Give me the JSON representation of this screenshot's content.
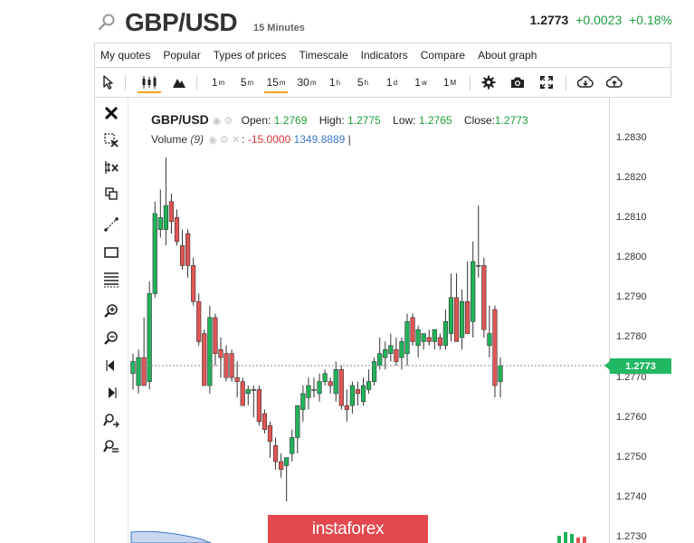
{
  "header": {
    "symbol": "GBP/USD",
    "timeframe": "15 Minutes",
    "price": "1.2773",
    "change": "+0.0023",
    "change_pct": "+0.18%",
    "search_icon": "search-icon"
  },
  "menu": {
    "items": [
      "My quotes",
      "Popular",
      "Types of prices",
      "Timescale",
      "Indicators",
      "Compare",
      "About graph"
    ]
  },
  "toolbar": {
    "timeframes": [
      {
        "base": "1",
        "sup": "m"
      },
      {
        "base": "5",
        "sup": "m"
      },
      {
        "base": "15",
        "sup": "m"
      },
      {
        "base": "30",
        "sup": "m"
      },
      {
        "base": "1",
        "sup": "h"
      },
      {
        "base": "5",
        "sup": "h"
      },
      {
        "base": "1",
        "sup": "d"
      },
      {
        "base": "1",
        "sup": "w"
      },
      {
        "base": "1",
        "sup": "M"
      }
    ],
    "active_timeframe": "15m",
    "icons": [
      "cursor-icon",
      "candlestick-icon",
      "mountain-icon",
      "gear-icon",
      "camera-icon",
      "fullscreen-icon",
      "download-icon",
      "upload-icon"
    ]
  },
  "tools": {
    "icons": [
      "close-icon",
      "delete-selection-icon",
      "delete-all-icon",
      "copy-icon",
      "line-icon",
      "rectangle-icon",
      "fibonacci-icon",
      "zoom-in-icon",
      "zoom-out-icon",
      "scroll-left-icon",
      "scroll-right-icon",
      "share-icon",
      "share-settings-icon"
    ]
  },
  "legend": {
    "symbol": "GBP/USD",
    "open_label": "Open:",
    "open": "1.2769",
    "high_label": "High:",
    "high": "1.2775",
    "low_label": "Low:",
    "low": "1.2765",
    "close_label": "Close:",
    "close": "1.2773",
    "volume_label": "Volume",
    "volume_param": "(9)",
    "volume_sep": ":",
    "volume_neg": "-15.0000",
    "volume_pos": "1349.8889",
    "volume_end": "|"
  },
  "axis": {
    "ticks": [
      "1.2830",
      "1.2820",
      "1.2810",
      "1.2800",
      "1.2790",
      "1.2780",
      "1.2770",
      "1.2760",
      "1.2750",
      "1.2740",
      "1.2730"
    ],
    "current_price": "1.2773"
  },
  "watermark": "instaforex",
  "colors": {
    "up": "#21b25a",
    "down": "#e05555",
    "accent": "#f0a31b",
    "price_tag": "#21b861"
  },
  "chart_data": {
    "type": "candlestick",
    "ylim": [
      1.2728,
      1.2836
    ],
    "last_price": 1.2773,
    "candles": [
      {
        "o": 1.2771,
        "h": 1.2776,
        "l": 1.2767,
        "c": 1.2774
      },
      {
        "o": 1.2768,
        "h": 1.2777,
        "l": 1.2766,
        "c": 1.2775
      },
      {
        "o": 1.2775,
        "h": 1.2785,
        "l": 1.2768,
        "c": 1.2768
      },
      {
        "o": 1.2769,
        "h": 1.2794,
        "l": 1.2767,
        "c": 1.2791
      },
      {
        "o": 1.2791,
        "h": 1.2814,
        "l": 1.279,
        "c": 1.2811
      },
      {
        "o": 1.2807,
        "h": 1.2817,
        "l": 1.2805,
        "c": 1.281
      },
      {
        "o": 1.2807,
        "h": 1.2825,
        "l": 1.2803,
        "c": 1.2813
      },
      {
        "o": 1.2814,
        "h": 1.2816,
        "l": 1.2806,
        "c": 1.2809
      },
      {
        "o": 1.281,
        "h": 1.2812,
        "l": 1.2803,
        "c": 1.2804
      },
      {
        "o": 1.2803,
        "h": 1.2807,
        "l": 1.2797,
        "c": 1.2798
      },
      {
        "o": 1.2806,
        "h": 1.2807,
        "l": 1.2795,
        "c": 1.2798
      },
      {
        "o": 1.2798,
        "h": 1.28,
        "l": 1.2788,
        "c": 1.2789
      },
      {
        "o": 1.2789,
        "h": 1.2791,
        "l": 1.2778,
        "c": 1.2779
      },
      {
        "o": 1.2781,
        "h": 1.2782,
        "l": 1.2768,
        "c": 1.2768
      },
      {
        "o": 1.2768,
        "h": 1.2788,
        "l": 1.2766,
        "c": 1.2785
      },
      {
        "o": 1.2785,
        "h": 1.2786,
        "l": 1.2773,
        "c": 1.2776
      },
      {
        "o": 1.2777,
        "h": 1.278,
        "l": 1.277,
        "c": 1.2775
      },
      {
        "o": 1.2776,
        "h": 1.2778,
        "l": 1.2769,
        "c": 1.277
      },
      {
        "o": 1.2776,
        "h": 1.2777,
        "l": 1.2769,
        "c": 1.277
      },
      {
        "o": 1.277,
        "h": 1.2774,
        "l": 1.2765,
        "c": 1.2769
      },
      {
        "o": 1.2769,
        "h": 1.277,
        "l": 1.2763,
        "c": 1.2763
      },
      {
        "o": 1.2766,
        "h": 1.2768,
        "l": 1.2763,
        "c": 1.2767
      },
      {
        "o": 1.2767,
        "h": 1.2768,
        "l": 1.276,
        "c": 1.2767
      },
      {
        "o": 1.2767,
        "h": 1.2768,
        "l": 1.2758,
        "c": 1.2759
      },
      {
        "o": 1.2761,
        "h": 1.2762,
        "l": 1.2756,
        "c": 1.2757
      },
      {
        "o": 1.2758,
        "h": 1.2759,
        "l": 1.275,
        "c": 1.2754
      },
      {
        "o": 1.2753,
        "h": 1.2755,
        "l": 1.2747,
        "c": 1.2749
      },
      {
        "o": 1.2749,
        "h": 1.2751,
        "l": 1.2745,
        "c": 1.2747
      },
      {
        "o": 1.2748,
        "h": 1.275,
        "l": 1.2739,
        "c": 1.275
      },
      {
        "o": 1.2751,
        "h": 1.2757,
        "l": 1.2749,
        "c": 1.2755
      },
      {
        "o": 1.2755,
        "h": 1.2763,
        "l": 1.2751,
        "c": 1.2763
      },
      {
        "o": 1.2762,
        "h": 1.2768,
        "l": 1.2759,
        "c": 1.2766
      },
      {
        "o": 1.2765,
        "h": 1.277,
        "l": 1.2762,
        "c": 1.2768
      },
      {
        "o": 1.2767,
        "h": 1.277,
        "l": 1.2765,
        "c": 1.2767
      },
      {
        "o": 1.2766,
        "h": 1.2771,
        "l": 1.2764,
        "c": 1.2769
      },
      {
        "o": 1.2769,
        "h": 1.2772,
        "l": 1.2768,
        "c": 1.2771
      },
      {
        "o": 1.2769,
        "h": 1.277,
        "l": 1.2766,
        "c": 1.2768
      },
      {
        "o": 1.2766,
        "h": 1.2774,
        "l": 1.2764,
        "c": 1.2772
      },
      {
        "o": 1.2772,
        "h": 1.2773,
        "l": 1.2762,
        "c": 1.2763
      },
      {
        "o": 1.2763,
        "h": 1.2767,
        "l": 1.2759,
        "c": 1.2762
      },
      {
        "o": 1.2763,
        "h": 1.2769,
        "l": 1.2761,
        "c": 1.2768
      },
      {
        "o": 1.2767,
        "h": 1.2769,
        "l": 1.2763,
        "c": 1.2766
      },
      {
        "o": 1.2764,
        "h": 1.277,
        "l": 1.2763,
        "c": 1.2768
      },
      {
        "o": 1.2767,
        "h": 1.2772,
        "l": 1.2766,
        "c": 1.2769
      },
      {
        "o": 1.2769,
        "h": 1.2775,
        "l": 1.2768,
        "c": 1.2774
      },
      {
        "o": 1.2773,
        "h": 1.278,
        "l": 1.2772,
        "c": 1.2776
      },
      {
        "o": 1.2775,
        "h": 1.2779,
        "l": 1.2772,
        "c": 1.2777
      },
      {
        "o": 1.2776,
        "h": 1.2781,
        "l": 1.2774,
        "c": 1.2778
      },
      {
        "o": 1.2777,
        "h": 1.278,
        "l": 1.2773,
        "c": 1.2774
      },
      {
        "o": 1.2775,
        "h": 1.278,
        "l": 1.2772,
        "c": 1.2779
      },
      {
        "o": 1.2776,
        "h": 1.2786,
        "l": 1.2773,
        "c": 1.2784
      },
      {
        "o": 1.2785,
        "h": 1.2786,
        "l": 1.2778,
        "c": 1.2779
      },
      {
        "o": 1.2778,
        "h": 1.2783,
        "l": 1.2775,
        "c": 1.2782
      },
      {
        "o": 1.2779,
        "h": 1.2781,
        "l": 1.2777,
        "c": 1.2781
      },
      {
        "o": 1.278,
        "h": 1.2782,
        "l": 1.2778,
        "c": 1.2779
      },
      {
        "o": 1.2779,
        "h": 1.2782,
        "l": 1.2777,
        "c": 1.2782
      },
      {
        "o": 1.278,
        "h": 1.2781,
        "l": 1.2777,
        "c": 1.2778
      },
      {
        "o": 1.2778,
        "h": 1.2787,
        "l": 1.2777,
        "c": 1.2784
      },
      {
        "o": 1.2781,
        "h": 1.2796,
        "l": 1.2779,
        "c": 1.279
      },
      {
        "o": 1.279,
        "h": 1.2796,
        "l": 1.2779,
        "c": 1.2779
      },
      {
        "o": 1.278,
        "h": 1.2792,
        "l": 1.2777,
        "c": 1.2789
      },
      {
        "o": 1.2789,
        "h": 1.2799,
        "l": 1.2781,
        "c": 1.2781
      },
      {
        "o": 1.2784,
        "h": 1.2804,
        "l": 1.278,
        "c": 1.2799
      },
      {
        "o": 1.2798,
        "h": 1.2813,
        "l": 1.2795,
        "c": 1.2798
      },
      {
        "o": 1.2798,
        "h": 1.28,
        "l": 1.278,
        "c": 1.2782
      },
      {
        "o": 1.2778,
        "h": 1.2788,
        "l": 1.2775,
        "c": 1.2781
      },
      {
        "o": 1.2787,
        "h": 1.2788,
        "l": 1.2765,
        "c": 1.2768
      },
      {
        "o": 1.2769,
        "h": 1.2775,
        "l": 1.2765,
        "c": 1.2773
      }
    ],
    "volume_histogram": "partial, cut off at bottom edge"
  }
}
